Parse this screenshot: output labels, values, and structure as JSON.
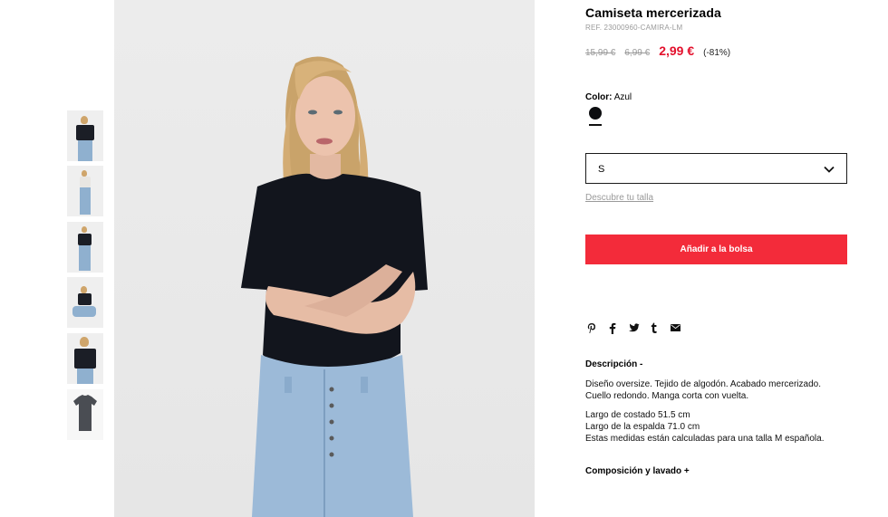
{
  "product": {
    "title": "Camiseta mercerizada",
    "ref": "REF. 23000960-CAMIRA-LM",
    "price_original": "15,99 €",
    "price_previous": "6,99 €",
    "price_current": "2,99 €",
    "discount": "(-81%)",
    "color_label": "Color:",
    "color_value": "Azul",
    "swatch_color": "#0c0d10"
  },
  "size_selector": {
    "value": "S"
  },
  "size_link": "Descubre tu talla",
  "add_to_bag": "Añadir a la bolsa",
  "share_icons": [
    "pinterest-icon",
    "facebook-icon",
    "twitter-icon",
    "tumblr-icon",
    "email-icon"
  ],
  "description": {
    "heading": "Descripción -",
    "lines": [
      "Diseño oversize. Tejido de algodón. Acabado mercerizado.",
      "Cuello redondo. Manga corta con vuelta.",
      "",
      "Largo de costado 51.5 cm",
      "Largo de la espalda 71.0 cm",
      "Estas medidas están calculadas para una talla M española."
    ]
  },
  "composition_heading": "Composición y lavado +",
  "thumbnails": [
    "front-arms-crossed",
    "front-full",
    "front-walking",
    "sitting",
    "front-close",
    "shirt-only"
  ],
  "colors": {
    "accent": "#f32b3a",
    "sale_price": "#e3102c",
    "muted": "#9a9a9a"
  }
}
